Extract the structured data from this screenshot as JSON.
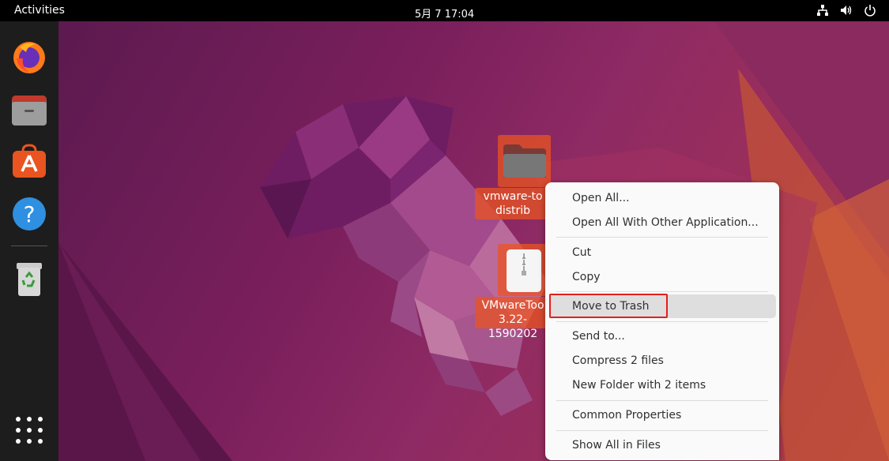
{
  "topbar": {
    "activities": "Activities",
    "clock": "5月 7  17:04"
  },
  "dock": {
    "items": [
      {
        "name": "Firefox",
        "icon": "firefox-icon"
      },
      {
        "name": "Files",
        "icon": "files-icon"
      },
      {
        "name": "Ubuntu Software",
        "icon": "software-icon"
      },
      {
        "name": "Help",
        "icon": "help-icon"
      },
      {
        "name": "Trash",
        "icon": "trash-icon"
      }
    ],
    "apps_icon": "show-apps-icon"
  },
  "desktop": {
    "icons": [
      {
        "label_line1": "vmware-to",
        "label_line2": "distrib",
        "type": "folder"
      },
      {
        "label_line1": "VMwareToo",
        "label_line2": "3.22-1590202",
        "type": "archive"
      }
    ]
  },
  "context_menu": {
    "items": [
      {
        "label": "Open All..."
      },
      {
        "label": "Open All With Other Application..."
      },
      {
        "label": "Cut"
      },
      {
        "label": "Copy"
      },
      {
        "label": "Move to Trash",
        "highlighted": true
      },
      {
        "label": "Send to..."
      },
      {
        "label": "Compress 2 files"
      },
      {
        "label": "New Folder with 2 items"
      },
      {
        "label": "Common Properties"
      },
      {
        "label": "Show All in Files"
      }
    ]
  },
  "colors": {
    "accent": "#e95420",
    "highlight_box": "#e0201c"
  }
}
